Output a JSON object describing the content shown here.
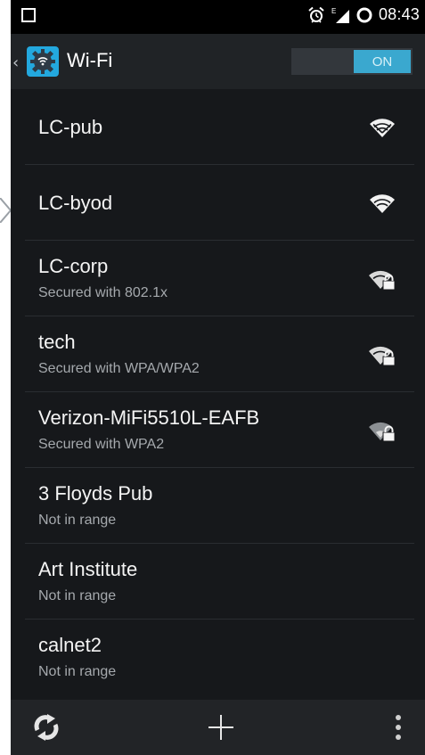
{
  "status_bar": {
    "time": "08:43",
    "icons": [
      "notification-square-icon",
      "alarm-icon",
      "signal-icon",
      "sync-icon"
    ]
  },
  "action_bar": {
    "title": "Wi-Fi",
    "toggle_label": "ON",
    "colors": {
      "accent": "#3aa8cf",
      "app_icon": "#23a8de"
    }
  },
  "networks": [
    {
      "ssid": "LC-pub",
      "detail": "",
      "signal_icon": "wifi-signal-icon",
      "secured": false
    },
    {
      "ssid": "LC-byod",
      "detail": "",
      "signal_icon": "wifi-signal-icon",
      "secured": false
    },
    {
      "ssid": "LC-corp",
      "detail": "Secured with 802.1x",
      "signal_icon": "wifi-lock-icon",
      "secured": true
    },
    {
      "ssid": "tech",
      "detail": "Secured with WPA/WPA2",
      "signal_icon": "wifi-lock-icon",
      "secured": true
    },
    {
      "ssid": "Verizon-MiFi5510L-EAFB",
      "detail": "Secured with WPA2",
      "signal_icon": "wifi-lock-icon",
      "secured": true
    },
    {
      "ssid": "3 Floyds Pub",
      "detail": "Not in range",
      "signal_icon": "",
      "secured": false
    },
    {
      "ssid": "Art Institute",
      "detail": "Not in range",
      "signal_icon": "",
      "secured": false
    },
    {
      "ssid": "calnet2",
      "detail": "Not in range",
      "signal_icon": "",
      "secured": false
    }
  ],
  "bottom_bar": {
    "actions": [
      "scan-icon",
      "add-network-icon",
      "overflow-menu-icon"
    ]
  }
}
